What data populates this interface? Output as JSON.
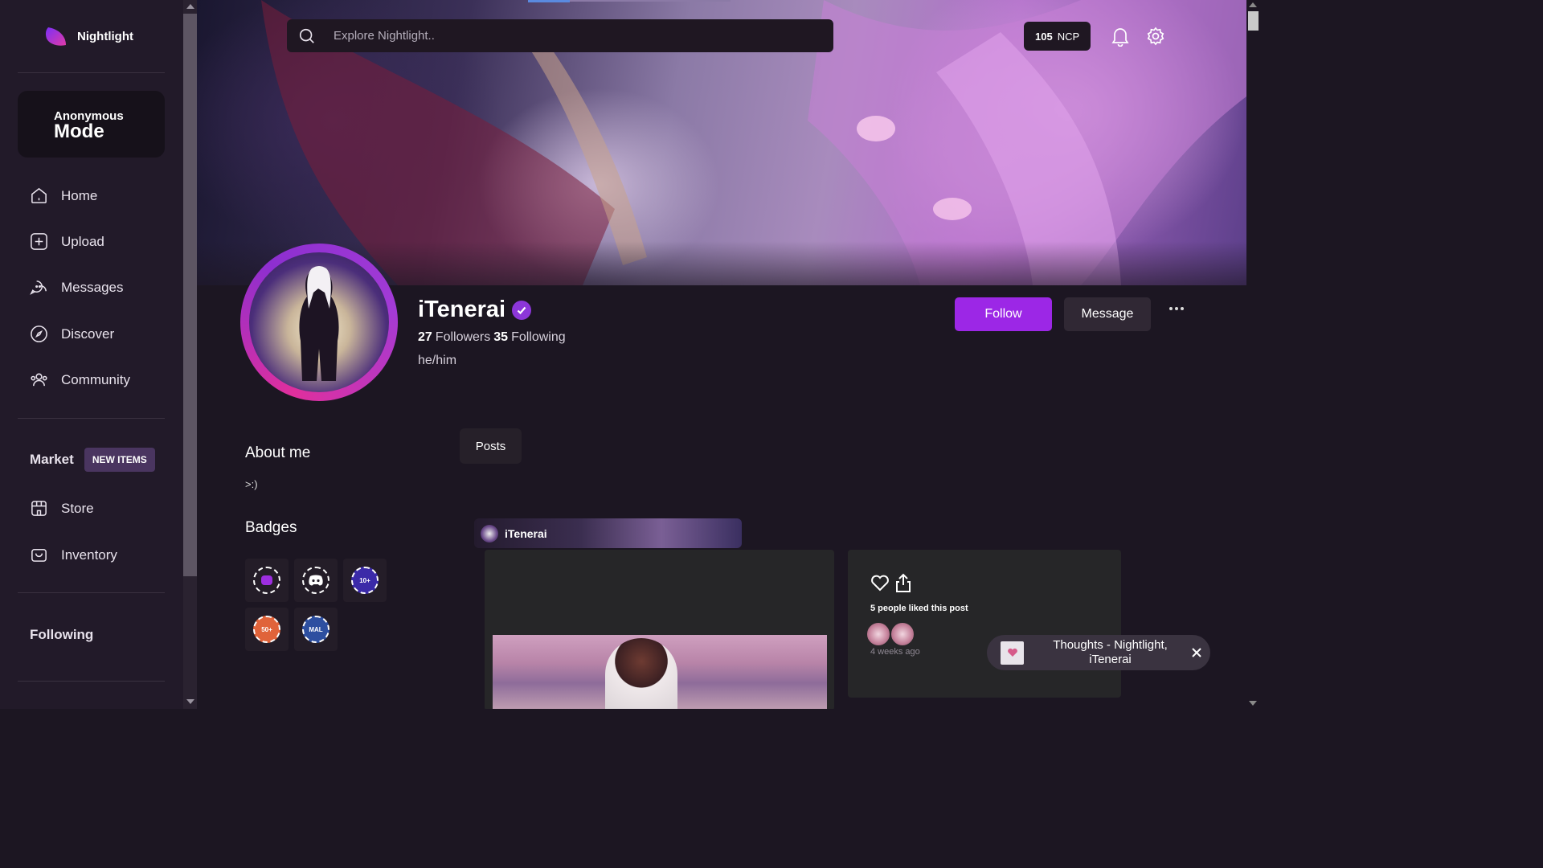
{
  "app": {
    "name": "Nightlight",
    "anonymous_line1": "Anonymous",
    "anonymous_line2": "Mode"
  },
  "sidebar": {
    "nav": [
      {
        "label": "Home",
        "icon": "home-icon"
      },
      {
        "label": "Upload",
        "icon": "upload-icon"
      },
      {
        "label": "Messages",
        "icon": "messages-icon"
      },
      {
        "label": "Discover",
        "icon": "compass-icon"
      },
      {
        "label": "Community",
        "icon": "community-icon"
      }
    ],
    "market_label": "Market",
    "market_badge": "NEW ITEMS",
    "market_items": [
      {
        "label": "Store",
        "icon": "store-icon"
      },
      {
        "label": "Inventory",
        "icon": "inventory-icon"
      }
    ],
    "following_label": "Following"
  },
  "header": {
    "search_placeholder": "Explore Nightlight..",
    "ncp_amount": "105",
    "ncp_unit": "NCP"
  },
  "profile": {
    "username": "iTenerai",
    "verified": true,
    "followers_count": "27",
    "followers_label": "Followers",
    "following_count": "35",
    "following_label": "Following",
    "pronouns": "he/him",
    "follow_label": "Follow",
    "message_label": "Message",
    "about_title": "About me",
    "about_text": ">:)",
    "badges_title": "Badges",
    "badges": [
      {
        "icon": "nightlight-badge-icon",
        "text": ""
      },
      {
        "icon": "discord-badge-icon",
        "text": ""
      },
      {
        "icon": "ten-plus-badge-icon",
        "text": "10+"
      },
      {
        "icon": "fifty-plus-badge-icon",
        "text": "50+"
      },
      {
        "icon": "mal-badge-icon",
        "text": "MAL"
      }
    ]
  },
  "tabs": {
    "posts_label": "Posts"
  },
  "post": {
    "author": "iTenerai",
    "likes_text": "5 people liked this post",
    "time_ago": "4 weeks ago"
  },
  "toast": {
    "text": "Thoughts - Nightlight, iTenerai"
  },
  "colors": {
    "accent": "#9c27e6",
    "sidebar_bg": "#221a29",
    "page_bg": "#1c1622",
    "verified": "#8c36d9"
  }
}
